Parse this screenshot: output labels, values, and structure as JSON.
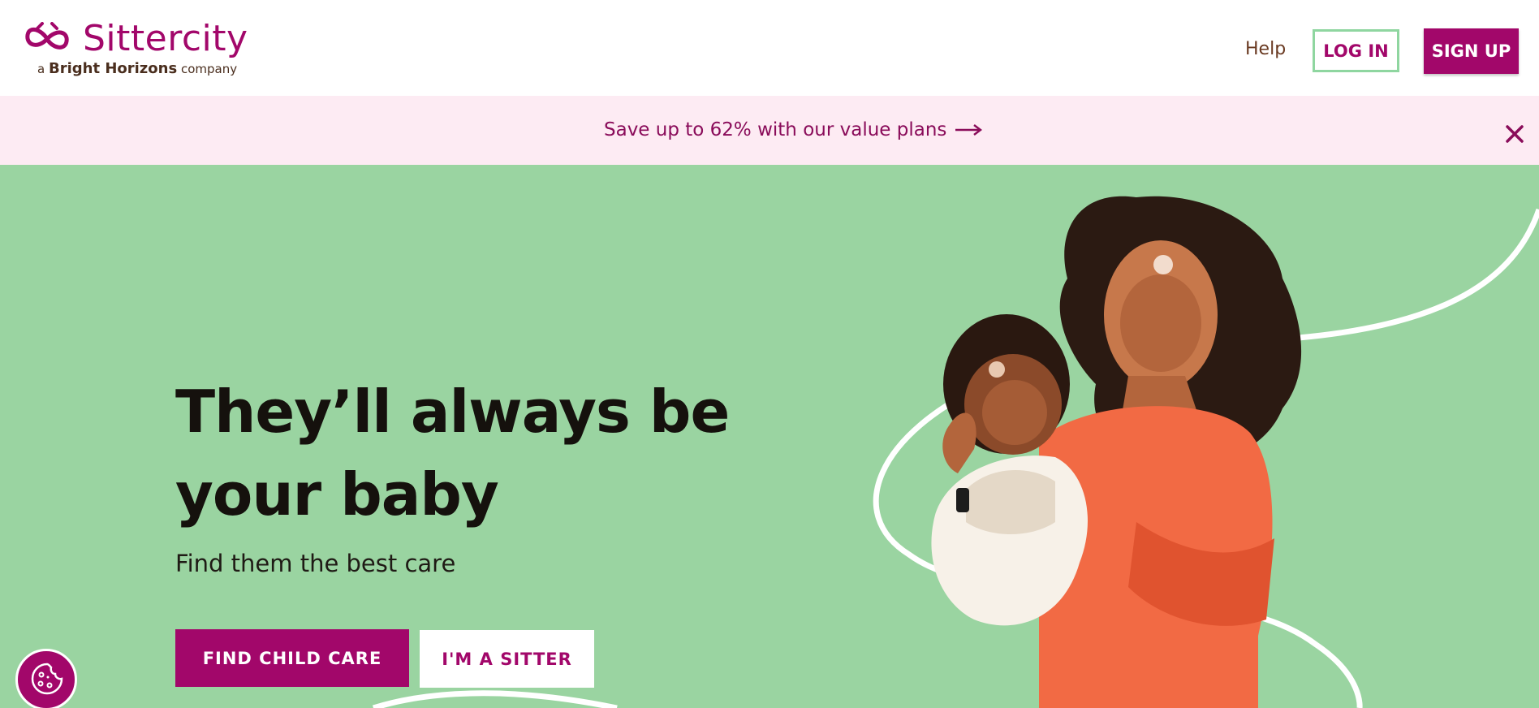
{
  "header": {
    "brand_name": "Sittercity",
    "brand_tagline_prefix": "a",
    "brand_tagline_company": "Bright Horizons",
    "brand_tagline_suffix": "company",
    "help_label": "Help",
    "login_label": "LOG IN",
    "signup_label": "SIGN UP"
  },
  "promo": {
    "text": "Save up to 62% with our value plans"
  },
  "hero": {
    "title": "They’ll always be your baby",
    "subtitle": "Find them the best care",
    "primary_cta": "FIND CHILD CARE",
    "secondary_cta": "I'M A SITTER"
  },
  "colors": {
    "brand": "#a2076a",
    "hero_bg": "#9ad4a1",
    "promo_bg": "#fdebf3",
    "login_border": "#8fd6a0"
  }
}
